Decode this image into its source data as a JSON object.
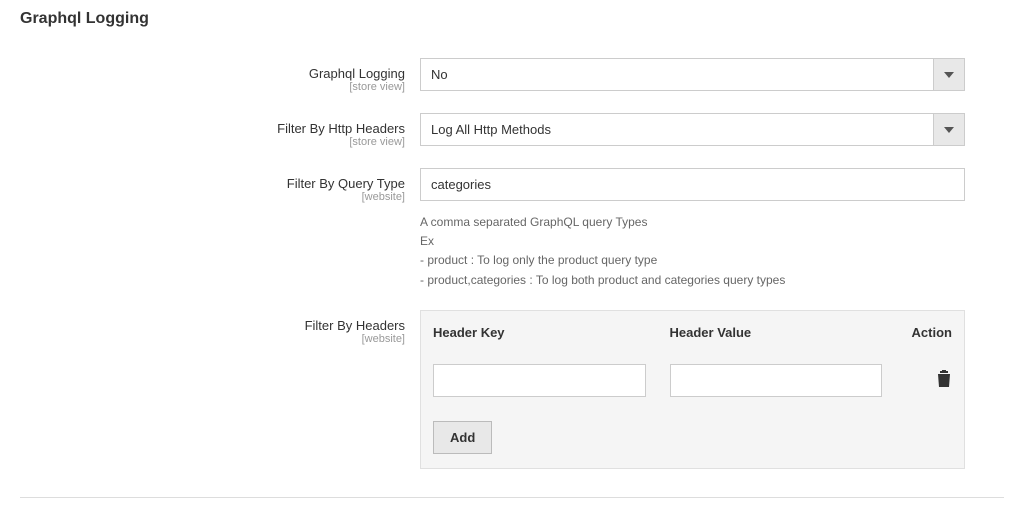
{
  "section_title": "Graphql Logging",
  "fields": {
    "graphql_logging": {
      "label": "Graphql Logging",
      "scope": "[store view]",
      "value": "No"
    },
    "filter_http_headers": {
      "label": "Filter By Http Headers",
      "scope": "[store view]",
      "value": "Log All Http Methods"
    },
    "filter_query_type": {
      "label": "Filter By Query Type",
      "scope": "[website]",
      "value": "categories",
      "help_line1": "A comma separated GraphQL query Types",
      "help_line2": "Ex",
      "help_line3": "- product : To log only the product query type",
      "help_line4": "- product,categories : To log both product and categories query types"
    },
    "filter_by_headers": {
      "label": "Filter By Headers",
      "scope": "[website]",
      "col_key": "Header Key",
      "col_value": "Header Value",
      "col_action": "Action",
      "rows": [
        {
          "key": "",
          "value": ""
        }
      ],
      "add_label": "Add"
    }
  }
}
